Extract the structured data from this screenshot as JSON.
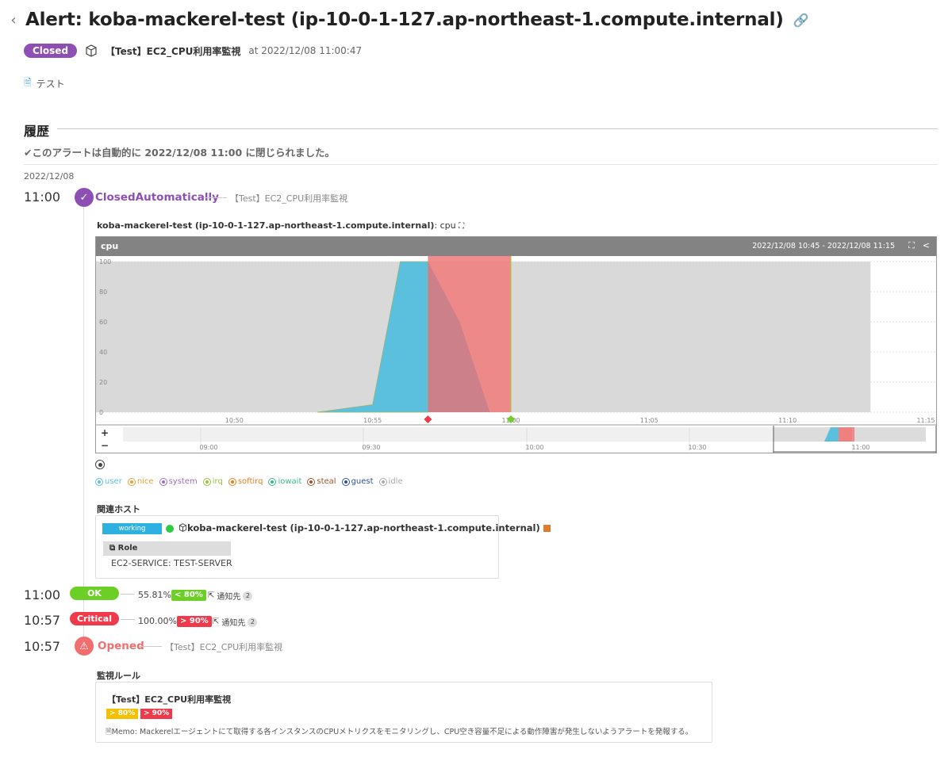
{
  "header": {
    "title": "Alert: koba-mackerel-test (ip-10-0-1-127.ap-northeast-1.compute.internal)",
    "status": "Closed",
    "monitor_name": "【Test】EC2_CPU利用率監視",
    "opened_at": "at 2022/12/08 11:00:47",
    "memo": "テスト"
  },
  "history": {
    "title": "履歴",
    "auto_closed_msg": "✔このアラートは自動的に 2022/12/08 11:00 に閉じられました。",
    "date": "2022/12/08",
    "events": {
      "closed": {
        "time": "11:00",
        "label": "ClosedAutomatically",
        "monitor": "【Test】EC2_CPU利用率監視"
      },
      "ok": {
        "time": "11:00",
        "label": "OK",
        "value": "55.81%",
        "threshold": "< 80%",
        "notify": "通知先",
        "notify_count": "2"
      },
      "critical": {
        "time": "10:57",
        "label": "Critical",
        "value": "100.00%",
        "threshold": "> 90%",
        "notify": "通知先",
        "notify_count": "2"
      },
      "opened": {
        "time": "10:57",
        "label": "Opened",
        "monitor": "【Test】EC2_CPU利用率監視"
      }
    }
  },
  "graph": {
    "title_bold": "koba-mackerel-test (ip-10-0-1-127.ap-northeast-1.compute.internal)",
    "title_suffix": ": cpu",
    "name": "cpu",
    "range": "2022/12/08 10:45 - 2022/12/08 11:15",
    "zoom_in": "+",
    "zoom_out": "−"
  },
  "chart_data": {
    "type": "area",
    "title": "cpu",
    "x_ticks": [
      "10:50",
      "10:55",
      "11:00",
      "11:05",
      "11:10",
      "11:15"
    ],
    "y_ticks": [
      "0",
      "20",
      "40",
      "60",
      "80",
      "100"
    ],
    "ylim": [
      0,
      100
    ],
    "series": [
      {
        "name": "user",
        "color": "#5bc0de",
        "x": [
          "10:53",
          "10:55",
          "10:56",
          "10:57",
          "10:57"
        ],
        "values": [
          0,
          5,
          100,
          100,
          0
        ]
      },
      {
        "name": "idle",
        "color": "#d9d9d9",
        "x": [
          "10:45",
          "11:13"
        ],
        "values": [
          100,
          100
        ]
      }
    ],
    "alert_region": {
      "from": "10:57",
      "to": "11:00",
      "color": "#f08080"
    },
    "navigator_ticks": [
      "09:00",
      "09:30",
      "10:00",
      "10:30",
      "11:00"
    ],
    "legend": [
      {
        "name": "user",
        "color": "#5bc0de"
      },
      {
        "name": "nice",
        "color": "#e6a23c"
      },
      {
        "name": "system",
        "color": "#a06cc8"
      },
      {
        "name": "irq",
        "color": "#9ac23c"
      },
      {
        "name": "softirq",
        "color": "#e67e22"
      },
      {
        "name": "iowait",
        "color": "#3cb88a"
      },
      {
        "name": "steal",
        "color": "#a0522d"
      },
      {
        "name": "guest",
        "color": "#2c4fa0"
      },
      {
        "name": "idle",
        "color": "#aaaaaa"
      }
    ]
  },
  "related_hosts": {
    "title": "関連ホスト",
    "status": "working",
    "host": "koba-mackerel-test (ip-10-0-1-127.ap-northeast-1.compute.internal)",
    "role_label": "Role",
    "role_value": "EC2-SERVICE: TEST-SERVER"
  },
  "monitor_rule": {
    "title": "監視ルール",
    "name": "【Test】EC2_CPU利用率監視",
    "warning": "> 80%",
    "critical": "> 90%",
    "memo": "Memo: Mackerelエージェントにて取得する各インスタンスのCPUメトリクスをモニタリングし、CPU空き容量不足による動作障害が発生しないようアラートを発報する。"
  },
  "colors": {
    "closed": "#8e4fb5",
    "ok": "#6ccf26",
    "critical": "#f0394a",
    "opened": "#f26d6d"
  }
}
